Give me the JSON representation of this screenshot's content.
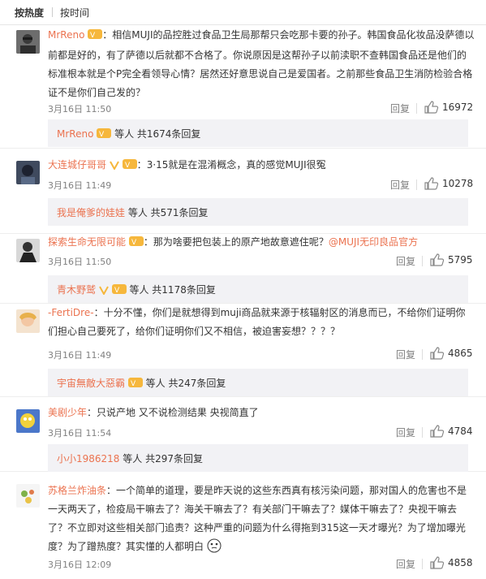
{
  "sort_tabs": {
    "hot": "按热度",
    "time": "按时间"
  },
  "reply_label": "回复",
  "comments": [
    {
      "user": "MrReno",
      "sep": "：",
      "text": "相信MUJI的品控胜过食品卫生局那帮只会吃那卡要的孙子。韩国食品化妆品没萨德以前都是好的，有了萨德以后就都不合格了。你说原因是这帮孙子以前渎职不查韩国食品还是他们的标准根本就是个P完全看领导心情？居然还好意思说自己是爱国者。之前那些食品卫生消防检验合格证不是你们自己发的？",
      "time": "3月16日 11:50",
      "likes": "16972",
      "sub_user": "MrReno",
      "sub_text": " 等人 共1674条回复"
    },
    {
      "user": "大连城仔哥哥",
      "sep": "：",
      "text": "3·15就是在混淆概念，真的感觉MUJI很冤",
      "time": "3月16日 11:49",
      "likes": "10278",
      "sub_user": "我是俺爹的娃娃",
      "sub_text": " 等人 共571条回复"
    },
    {
      "user": "探索生命无限可能",
      "sep": "：",
      "text": "那为啥要把包装上的原产地故意遮住呢？",
      "link": "@MUJI无印良品官方",
      "time": "3月16日 11:50",
      "likes": "5795",
      "sub_user": "青木野鹫",
      "sub_text": " 等人 共1178条回复"
    },
    {
      "user": "-FertiDre-",
      "sep": "：",
      "text": "十分不懂，你们是就想得到muji商品就来源于核辐射区的消息而已，不给你们证明你们担心自己要死了，给你们证明你们又不相信，被迫害妄想？？？？",
      "time": "3月16日 11:49",
      "likes": "4865",
      "sub_user": "宇宙無敵大惡霸",
      "sub_text": " 等人 共247条回复"
    },
    {
      "user": "美剧少年",
      "sep": "：",
      "text": "只说产地 又不说检测结果 央视简直了",
      "time": "3月16日 11:54",
      "likes": "4784",
      "sub_user": "小小1986218",
      "sub_text": " 等人 共297条回复"
    },
    {
      "user": "苏格兰炸油条",
      "sep": "：",
      "text": "一个简单的道理，要是昨天说的这些东西真有核污染问题，那对国人的危害也不是一天两天了，检疫局干嘛去了？海关干嘛去了？有关部门干嘛去了？媒体干嘛去了？央视干嘛去了？不立即对这些相关部门追责？这种严重的问题为什么得拖到315这一天才曝光？为了增加曝光度？为了蹭热度？其实懂的人都明白",
      "time": "3月16日 12:09",
      "likes": "4858"
    }
  ],
  "colors": {
    "username": "#eb7350",
    "meta": "#808080",
    "subbox": "#f2f2f5"
  }
}
